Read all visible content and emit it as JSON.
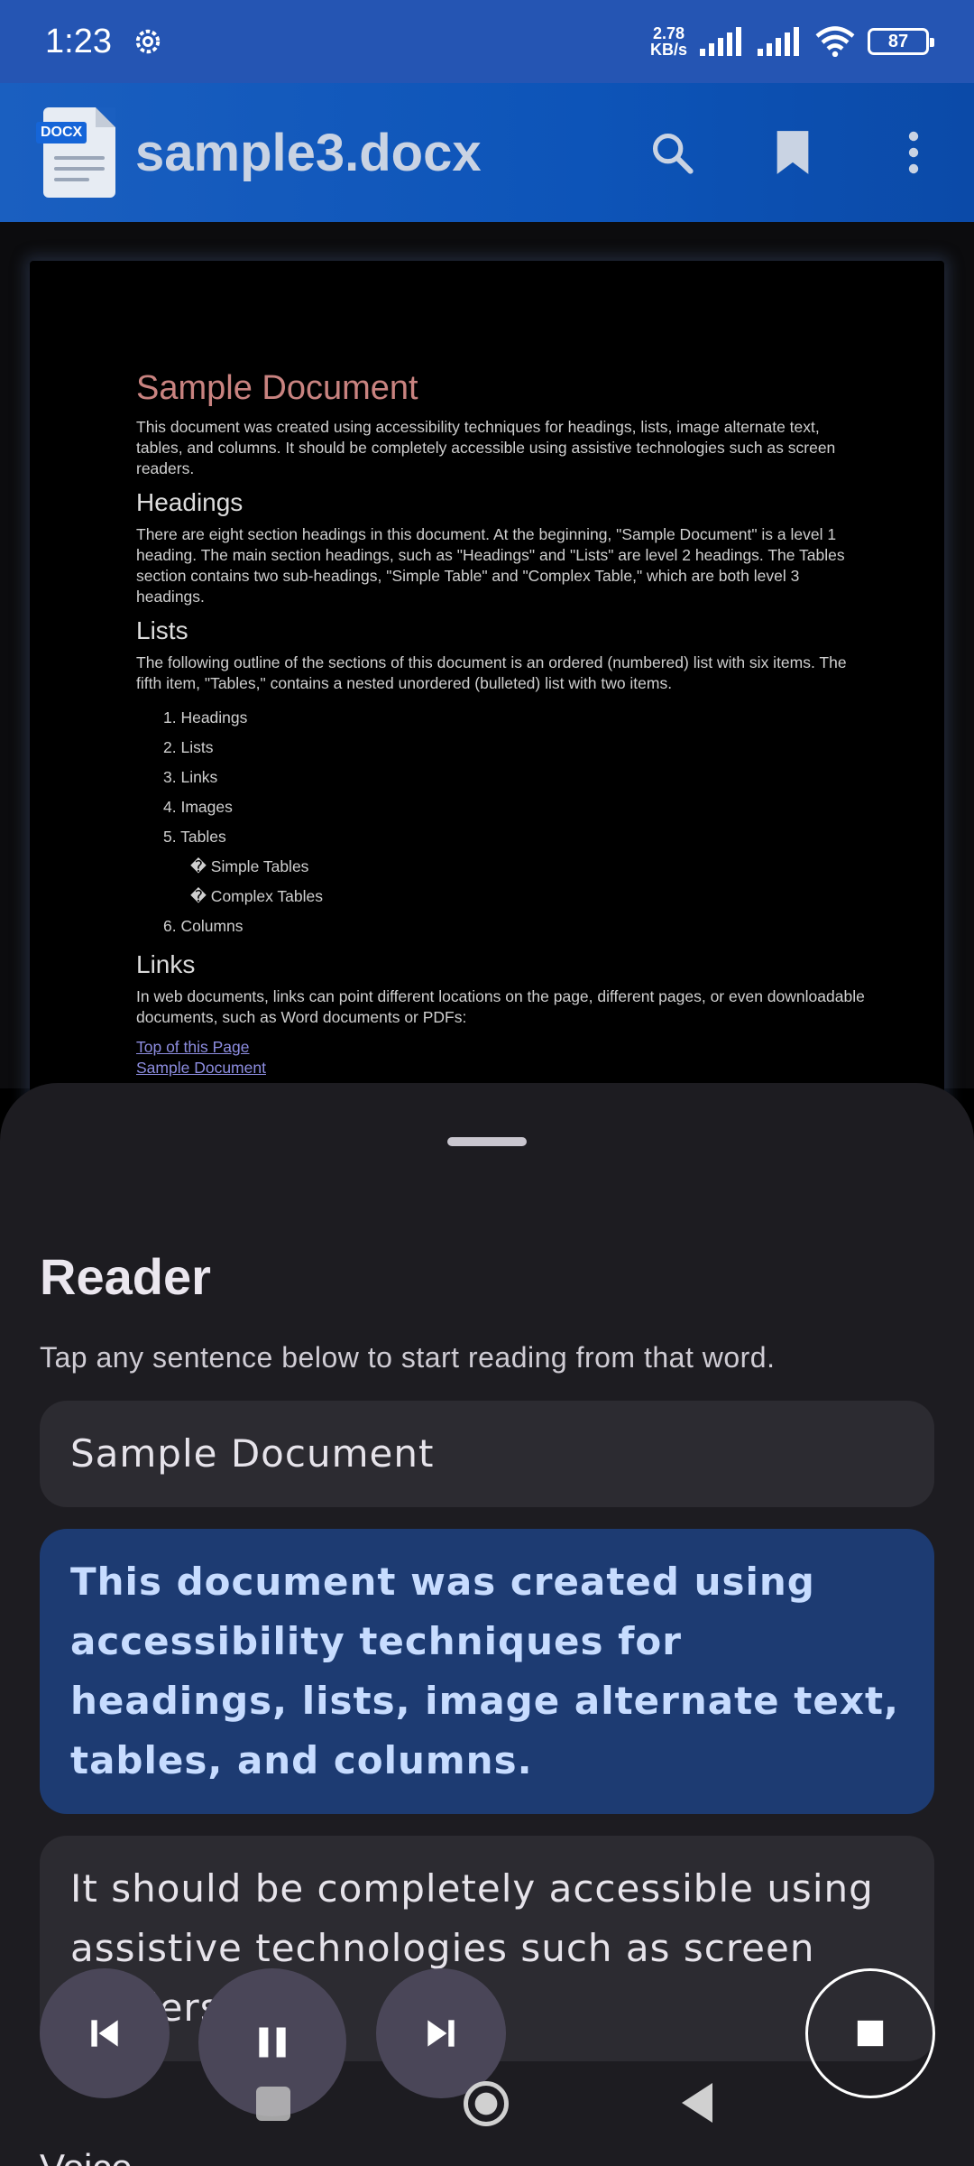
{
  "status_bar": {
    "time": "1:23",
    "net_speed_value": "2.78",
    "net_speed_unit": "KB/s",
    "battery": "87"
  },
  "app_bar": {
    "file_badge": "DOCX",
    "title": "sample3.docx",
    "icons": [
      "search-icon",
      "bookmark-icon",
      "more-vert-icon"
    ]
  },
  "document": {
    "title": "Sample Document",
    "intro": "This document was created using accessibility techniques for headings, lists, image alternate text, tables, and columns. It should be completely accessible using assistive technologies such as screen readers.",
    "headings_title": "Headings",
    "headings_text": "There are eight section headings in this document. At the beginning, \"Sample Document\" is a level 1 heading. The main section headings, such as \"Headings\" and \"Lists\" are level 2 headings. The Tables section contains two sub-headings, \"Simple Table\" and \"Complex Table,\" which are both level 3 headings.",
    "lists_title": "Lists",
    "lists_text": "The following outline of the sections of this document is an ordered (numbered) list with six items. The fifth item, \"Tables,\" contains a nested unordered (bulleted) list with two items.",
    "list_items": [
      "1. Headings",
      "2. Lists",
      "3. Links",
      "4. Images",
      "5. Tables"
    ],
    "sub_items": [
      "� Simple Tables",
      "� Complex Tables"
    ],
    "last_item": "6. Columns",
    "links_title": "Links",
    "links_text": "In web documents, links can point different locations on the page, different pages, or even downloadable documents, such as Word documents or PDFs:",
    "link1": "Top of this Page",
    "link2": "Sample Document"
  },
  "reader": {
    "title": "Reader",
    "hint": "Tap any sentence below to start reading from that word.",
    "sentences": [
      "Sample Document",
      "This document was created using accessibility techniques for headings, lists, image alternate text, tables, and columns.",
      "It should be completely accessible using assistive technologies such as screen readers."
    ],
    "voice_label": "Voice",
    "controls": [
      "skip-previous-icon",
      "pause-icon",
      "skip-next-icon",
      "stop-icon"
    ]
  },
  "colors": {
    "status_bar": "#2555b3",
    "app_bar": "#1a5fc0",
    "active_sentence_bg": "#1d3b72",
    "active_sentence_text": "#c7dcff",
    "sheet_bg": "#1d1c21",
    "doc_title": "#c98380"
  }
}
